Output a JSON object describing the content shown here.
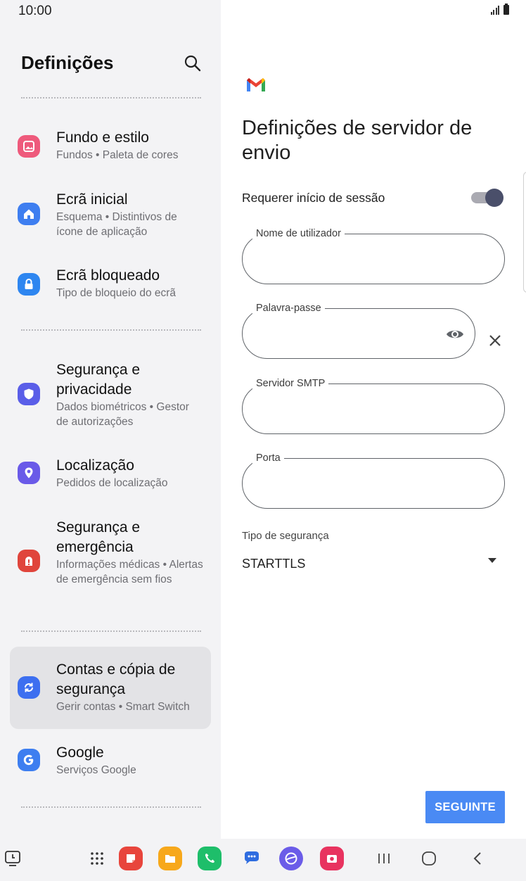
{
  "status_bar": {
    "time": "10:00"
  },
  "left_pane": {
    "title": "Definições",
    "items": [
      {
        "title": "Fundo e estilo",
        "subtitle": "Fundos  •  Paleta de cores",
        "color": "#ee5a7c",
        "icon": "wallpaper-icon"
      },
      {
        "title": "Ecrã inicial",
        "subtitle": "Esquema  •  Distintivos de ícone de aplicação",
        "color": "#3e7ef0",
        "icon": "home-icon"
      },
      {
        "title": "Ecrã bloqueado",
        "subtitle": "Tipo de bloqueio do ecrã",
        "color": "#2e86f0",
        "icon": "lock-icon"
      },
      {
        "title": "Segurança e privacidade",
        "subtitle": "Dados biométricos  •  Gestor de autorizações",
        "color": "#5a5ee8",
        "icon": "shield-icon"
      },
      {
        "title": "Localização",
        "subtitle": "Pedidos de localização",
        "color": "#6a5ae8",
        "icon": "location-icon"
      },
      {
        "title": "Segurança e emergência",
        "subtitle": "Informações médicas  •  Alertas de emergência sem fios",
        "color": "#e0453c",
        "icon": "emergency-icon"
      },
      {
        "title": "Contas e cópia de segurança",
        "subtitle": "Gerir contas  •  Smart Switch",
        "color": "#3d6ff0",
        "icon": "sync-icon",
        "selected": true
      },
      {
        "title": "Google",
        "subtitle": "Serviços Google",
        "color": "#3d7ef0",
        "icon": "google-icon"
      }
    ]
  },
  "right_pane": {
    "title": "Definições de servidor de envio",
    "require_login_label": "Requerer início de sessão",
    "require_login_on": true,
    "fields": {
      "username": {
        "label": "Nome de utilizador",
        "value": ""
      },
      "password": {
        "label": "Palavra-passe",
        "value": ""
      },
      "smtp_server": {
        "label": "Servidor SMTP",
        "value": ""
      },
      "port": {
        "label": "Porta",
        "value": ""
      }
    },
    "security_type_label": "Tipo de segurança",
    "security_type_value": "STARTTLS",
    "next_button": "SEGUINTE",
    "accent_color": "#4a8af4"
  },
  "nav_bar": {
    "apps": [
      "apps-grid-icon",
      "notes-icon",
      "my-files-icon",
      "phone-icon",
      "messages-icon",
      "internet-icon",
      "screen-recorder-icon"
    ],
    "buttons": [
      "recents-icon",
      "home-button-icon",
      "back-icon"
    ]
  }
}
